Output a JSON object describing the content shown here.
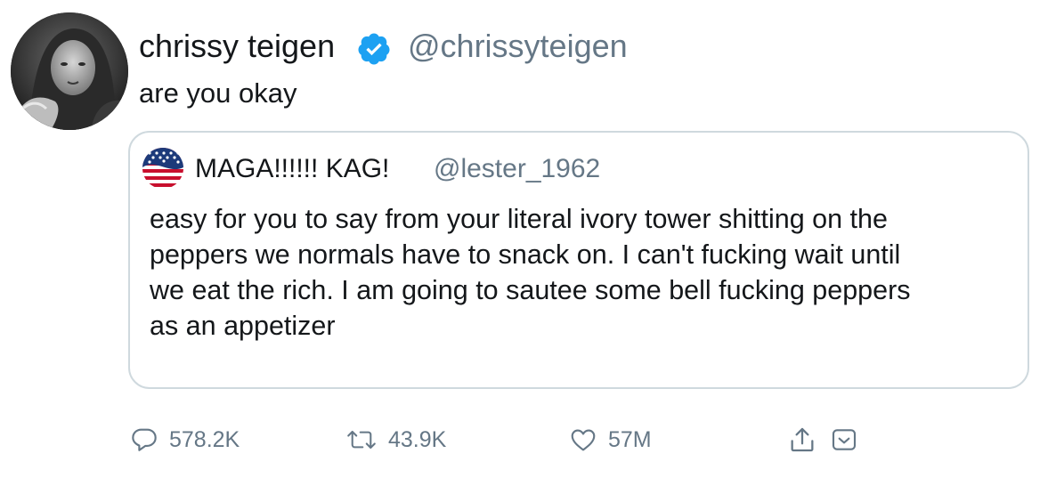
{
  "tweet": {
    "author": {
      "display_name": "chrissy teigen",
      "handle": "@chrissyteigen",
      "verified": true
    },
    "text": "are you okay",
    "quoted_tweet": {
      "author": {
        "display_name": "MAGA!!!!!! KAG!",
        "handle": "@lester_1962",
        "avatar": "us-flag-icon"
      },
      "lines": [
        "easy for you to say from your literal ivory tower shitting on the",
        "peppers we normals have to snack on. I can't fucking wait until",
        "we eat the rich. I am going to sautee some bell fucking peppers",
        "as an appetizer"
      ]
    },
    "actions": {
      "replies": "578.2K",
      "retweets": "43.9K",
      "likes": "57M"
    }
  },
  "colors": {
    "text": "#14171a",
    "secondary": "#657786",
    "verified": "#1da1f2",
    "card_border": "#cfd9de"
  },
  "icons": {
    "reply": "reply-icon",
    "retweet": "retweet-icon",
    "like": "heart-icon",
    "share": "share-icon",
    "dm": "dm-icon",
    "verified": "verified-badge-icon"
  }
}
